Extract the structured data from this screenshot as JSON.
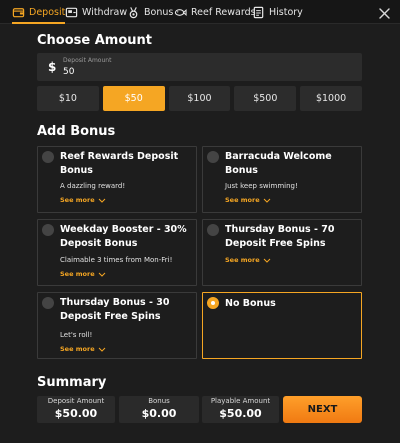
{
  "tabs": [
    {
      "label": "Deposit",
      "icon": "wallet-icon",
      "active": true
    },
    {
      "label": "Withdraw",
      "icon": "withdraw-icon",
      "active": false
    },
    {
      "label": "Bonus",
      "icon": "medal-icon",
      "active": false
    },
    {
      "label": "Reef Rewards",
      "icon": "fish-icon",
      "active": false
    },
    {
      "label": "History",
      "icon": "document-icon",
      "active": false
    }
  ],
  "close_icon": "close-icon",
  "choose_amount": {
    "heading": "Choose Amount",
    "currency_symbol": "$",
    "field_label": "Deposit Amount",
    "field_value": "50",
    "presets": [
      "$10",
      "$50",
      "$100",
      "$500",
      "$1000"
    ],
    "selected_preset": "$50"
  },
  "add_bonus": {
    "heading": "Add Bonus",
    "see_more_label": "See more",
    "cards": [
      {
        "title": "Reef Rewards Deposit Bonus",
        "description": "A dazzling reward!",
        "has_see_more": true,
        "selected": false
      },
      {
        "title": "Barracuda Welcome Bonus",
        "description": "Just keep swimming!",
        "has_see_more": true,
        "selected": false
      },
      {
        "title": "Weekday Booster - 30% Deposit Bonus",
        "description": "Claimable 3 times from Mon-Fri!",
        "has_see_more": true,
        "selected": false
      },
      {
        "title": "Thursday Bonus - 70 Deposit Free Spins",
        "description": "",
        "has_see_more": true,
        "selected": false
      },
      {
        "title": "Thursday Bonus - 30 Deposit Free Spins",
        "description": "Let's roll!",
        "has_see_more": true,
        "selected": false
      },
      {
        "title": "No Bonus",
        "description": "",
        "has_see_more": false,
        "selected": true
      }
    ]
  },
  "summary": {
    "heading": "Summary",
    "deposit_label": "Deposit Amount",
    "deposit_value": "$50.00",
    "bonus_label": "Bonus",
    "bonus_value": "$0.00",
    "playable_label": "Playable Amount",
    "playable_value": "$50.00",
    "next_label": "NEXT"
  },
  "colors": {
    "accent": "#f5a623",
    "background": "#1d1d1d",
    "field": "#2c2c2c"
  }
}
